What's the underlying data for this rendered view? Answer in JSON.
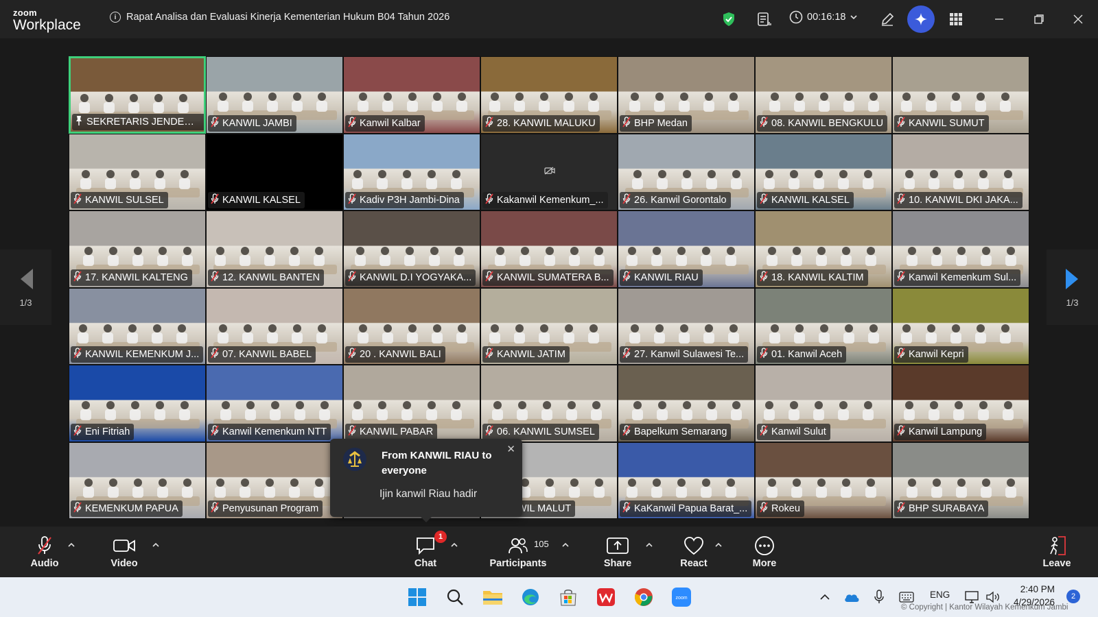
{
  "app": {
    "logo_line1": "zoom",
    "logo_line2": "Workplace"
  },
  "meeting": {
    "title": "Rapat Analisa dan Evaluasi Kinerja Kementerian Hukum B04 Tahun 2026",
    "timer": "00:16:18"
  },
  "gallery": {
    "page_left": "1/3",
    "page_right": "1/3",
    "participants": [
      {
        "name": "SEKRETARIS JENDERAL",
        "pinned": true,
        "active": true,
        "bg": "#7a5a3a"
      },
      {
        "name": "KANWIL JAMBI",
        "bg": "#9aa4a8"
      },
      {
        "name": "Kanwil Kalbar",
        "bg": "#8a4a4a"
      },
      {
        "name": "28. KANWIL MALUKU",
        "bg": "#8a6a3a"
      },
      {
        "name": "BHP Medan",
        "bg": "#9a8c7a"
      },
      {
        "name": "08. KANWIL BENGKULU",
        "bg": "#a49680"
      },
      {
        "name": "KANWIL SUMUT",
        "bg": "#a8a090"
      },
      {
        "name": "KANWIL SULSEL",
        "bg": "#b8b4ac"
      },
      {
        "name": "KANWIL KALSEL",
        "bg": "#000000",
        "video_off": true
      },
      {
        "name": "Kadiv P3H Jambi-Dina",
        "bg": "#8aa8c8"
      },
      {
        "name": "Kakanwil Kemenkum_...",
        "bg": "#2a2a2a",
        "video_off": true
      },
      {
        "name": "26.  Kanwil Gorontalo",
        "bg": "#a0a8b0"
      },
      {
        "name": "KANWIL KALSEL",
        "bg": "#6a7e8c"
      },
      {
        "name": "10. KANWIL DKI JAKA...",
        "bg": "#b4aca4"
      },
      {
        "name": "17. KANWIL KALTENG",
        "bg": "#a8a4a0"
      },
      {
        "name": "12. KANWIL BANTEN",
        "bg": "#c8c0b8"
      },
      {
        "name": "KANWIL D.I YOGYAKA...",
        "bg": "#5a5048"
      },
      {
        "name": "KANWIL SUMATERA B...",
        "bg": "#7a4a48"
      },
      {
        "name": "KANWIL RIAU",
        "bg": "#6a7494"
      },
      {
        "name": "18. KANWIL KALTIM",
        "bg": "#a09070"
      },
      {
        "name": "Kanwil Kemenkum Sul...",
        "bg": "#8c8c90"
      },
      {
        "name": "KANWIL KEMENKUM J...",
        "bg": "#8890a0"
      },
      {
        "name": "07. KANWIL BABEL",
        "bg": "#c4b8b0"
      },
      {
        "name": "20 . KANWIL BALI",
        "bg": "#907860"
      },
      {
        "name": "KANWIL JATIM",
        "bg": "#b4ae9c"
      },
      {
        "name": "27. Kanwil Sulawesi Te...",
        "bg": "#a09a94"
      },
      {
        "name": "01. Kanwil Aceh",
        "bg": "#7c8278"
      },
      {
        "name": "Kanwil Kepri",
        "bg": "#8a8a3a"
      },
      {
        "name": "Eni Fitriah",
        "bg": "#1a4aa8"
      },
      {
        "name": "Kanwil Kemenkum NTT",
        "bg": "#4a6ab0"
      },
      {
        "name": "KANWIL PABAR",
        "bg": "#b0a89c"
      },
      {
        "name": "06. KANWIL SUMSEL",
        "bg": "#b4aca0"
      },
      {
        "name": "Bapelkum Semarang",
        "bg": "#6a6050"
      },
      {
        "name": "Kanwil Sulut",
        "bg": "#b8b0a8"
      },
      {
        "name": "Kanwil Lampung",
        "bg": "#5a3a2a"
      },
      {
        "name": "KEMENKUM PAPUA",
        "bg": "#a8aab0"
      },
      {
        "name": "Penyusunan Program",
        "bg": "#a89888"
      },
      {
        "name": "",
        "bg": "#8c8c8c"
      },
      {
        "name": "KANWIL MALUT",
        "bg": "#b4b4b4"
      },
      {
        "name": "KaKanwil Papua Barat_...",
        "bg": "#3a5aa8"
      },
      {
        "name": "Rokeu",
        "bg": "#6a5040"
      },
      {
        "name": "BHP SURABAYA",
        "bg": "#8a8c88"
      }
    ]
  },
  "chat_popup": {
    "from": "From KANWIL RIAU to everyone",
    "message": "Ijin kanwil Riau hadir"
  },
  "toolbar": {
    "audio": "Audio",
    "video": "Video",
    "chat": "Chat",
    "chat_badge": "1",
    "participants": "Participants",
    "participants_count": "105",
    "share": "Share",
    "react": "React",
    "more": "More",
    "leave": "Leave"
  },
  "taskbar": {
    "lang": "ENG",
    "time": "2:40 PM",
    "date": "4/29/2026",
    "notifications": "2",
    "copyright": "© Copyright | Kantor Wilayah Kemenkum Jambi"
  },
  "colors": {
    "active_border": "#3fd07b",
    "mic_muted": "#e0393e",
    "ai_button": "#3b5bdb",
    "chat_badge": "#e02828"
  }
}
